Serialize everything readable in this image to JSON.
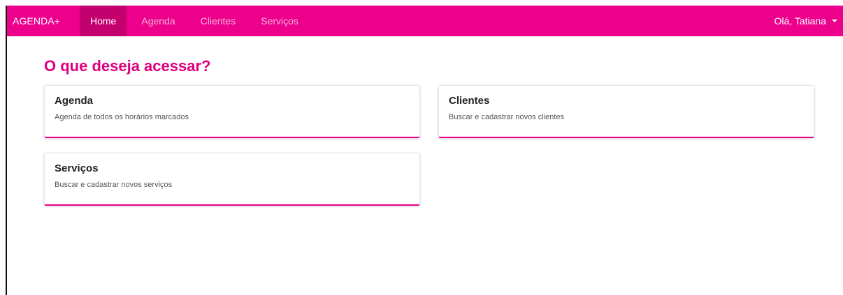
{
  "navbar": {
    "brand": "AGENDA+",
    "links": [
      {
        "label": "Home",
        "active": true
      },
      {
        "label": "Agenda",
        "active": false
      },
      {
        "label": "Clientes",
        "active": false
      },
      {
        "label": "Serviços",
        "active": false
      }
    ],
    "user_greeting": "Olá, Tatiana",
    "user_icon": "chevron-down-icon"
  },
  "main": {
    "title": "O que deseja acessar?",
    "cards": [
      {
        "title": "Agenda",
        "description": "Agenda de todos os horários marcados"
      },
      {
        "title": "Clientes",
        "description": "Buscar e cadastrar novos clientes"
      },
      {
        "title": "Serviços",
        "description": "Buscar e cadastrar novos serviços"
      }
    ]
  },
  "colors": {
    "brand": "#ec008c",
    "title": "#e0007f",
    "nav_active_bg": "#c4006f",
    "nav_inactive_text": "#f7b3da"
  }
}
